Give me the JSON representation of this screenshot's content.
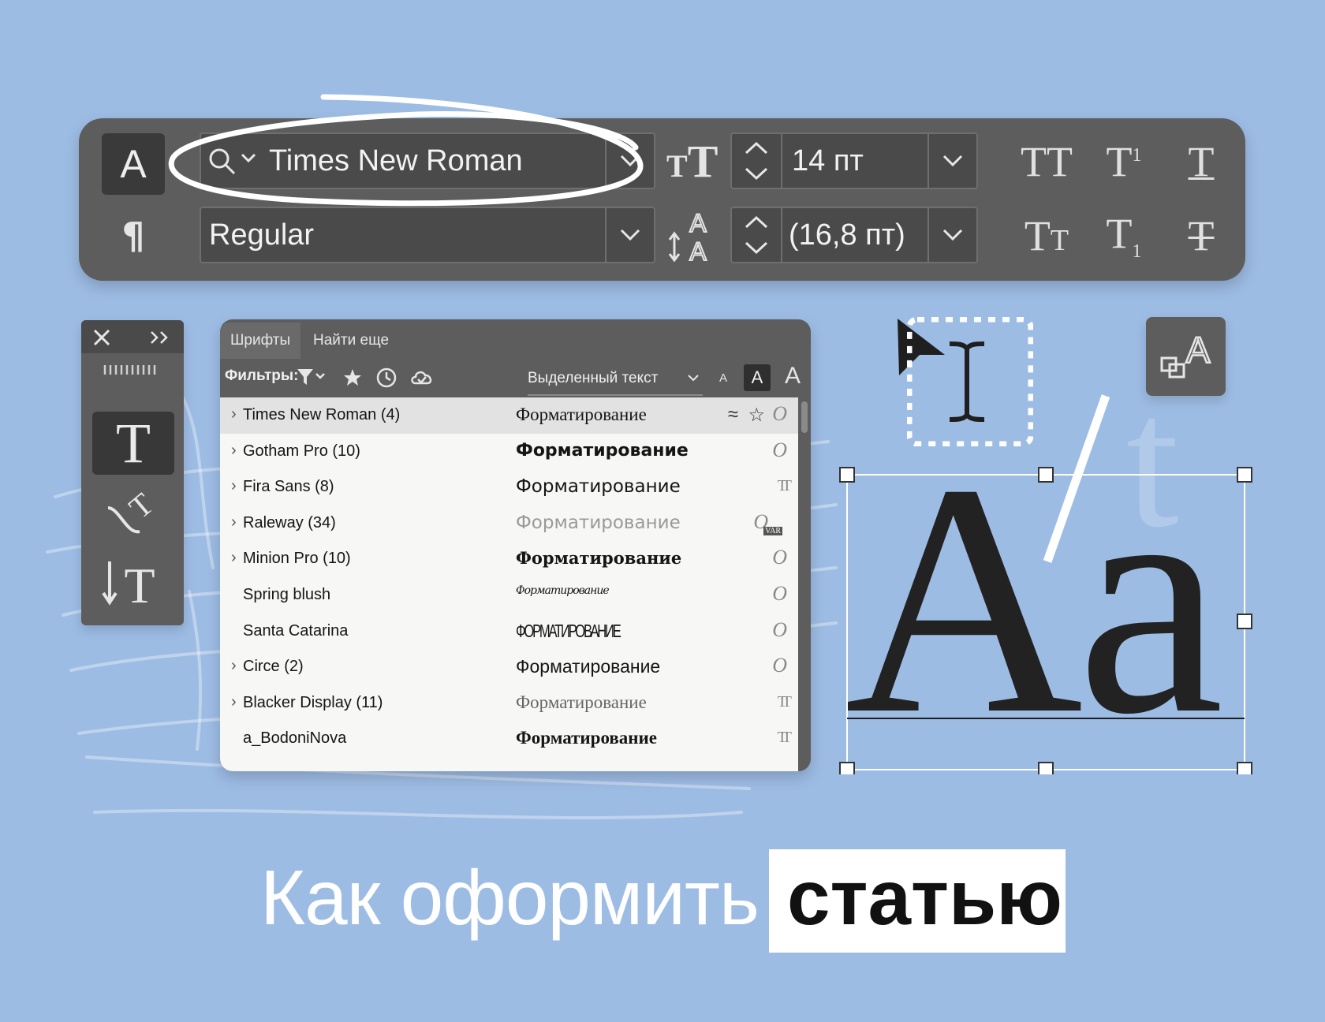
{
  "control_bar": {
    "font_family": "Times New Roman",
    "font_style": "Regular",
    "font_size": "14 пт",
    "leading": "(16,8 пт)"
  },
  "fonts_panel": {
    "tabs": [
      "Шрифты",
      "Найти еще"
    ],
    "filters_label": "Фильтры:",
    "preview_select": "Выделенный текст",
    "size_small": "A",
    "size_medium": "A",
    "size_large": "A",
    "fonts": [
      {
        "name": "Times New Roman (4)",
        "sample": "Форматирование",
        "expandable": true,
        "selected": true,
        "icon": "opentype-icon"
      },
      {
        "name": "Gotham Pro (10)",
        "sample": "Форматирование",
        "expandable": true,
        "selected": false,
        "icon": "opentype-icon"
      },
      {
        "name": "Fira Sans (8)",
        "sample": "Форматирование",
        "expandable": true,
        "selected": false,
        "icon": "truetype-icon"
      },
      {
        "name": "Raleway (34)",
        "sample": "Форматирование",
        "expandable": true,
        "selected": false,
        "icon": "variable-font-icon"
      },
      {
        "name": "Minion Pro (10)",
        "sample": "Форматирование",
        "expandable": true,
        "selected": false,
        "icon": "opentype-icon"
      },
      {
        "name": "Spring blush",
        "sample": "Форматирование",
        "expandable": false,
        "selected": false,
        "icon": "opentype-icon"
      },
      {
        "name": "Santa Catarina",
        "sample": "ФОРМАТИРОВАНИЕ",
        "expandable": false,
        "selected": false,
        "icon": "opentype-icon"
      },
      {
        "name": "Circe (2)",
        "sample": "Форматирование",
        "expandable": true,
        "selected": false,
        "icon": "opentype-icon"
      },
      {
        "name": "Blacker Display (11)",
        "sample": "Форматирование",
        "expandable": true,
        "selected": false,
        "icon": "truetype-icon"
      },
      {
        "name": "a_BodoniNova",
        "sample": "Форматирование",
        "expandable": false,
        "selected": false,
        "icon": "truetype-icon"
      }
    ]
  },
  "art": {
    "big_letters": "Aa",
    "ghost_letter": "t",
    "glyph_letter": "A"
  },
  "headline": {
    "light": "Как оформить",
    "bold": "статью"
  },
  "colors": {
    "background": "#9dbce4",
    "panel": "#5d5d5d",
    "panel_dark": "#3a3a3a"
  }
}
